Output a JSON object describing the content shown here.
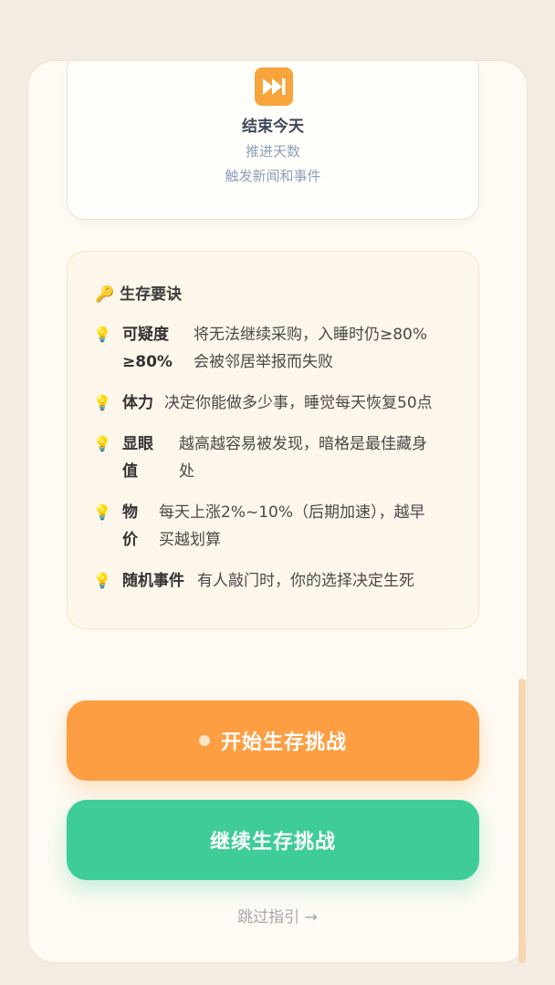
{
  "end_day_card": {
    "icon": "fast-forward-icon",
    "title": "结束今天",
    "desc_line1": "推进天数",
    "desc_line2": "触发新闻和事件"
  },
  "tips": {
    "title": "生存要诀",
    "title_icon": "key-icon",
    "bullet_icon": "lightbulb-icon",
    "items": [
      {
        "label": "可疑度≥80%",
        "label_line1": "可疑度",
        "label_line2": "≥80%",
        "text": "将无法继续采购，入睡时仍≥80%会被邻居举报而失败",
        "text_line1": "将无法继续采购，入睡时仍≥80%",
        "text_line2": "会被邻居举报而失败"
      },
      {
        "label": "体力",
        "text": "决定你能做多少事，睡觉每天恢复50点"
      },
      {
        "label": "显眼值",
        "label_line1": "显眼",
        "label_line2": "值",
        "text": "越高越容易被发现，暗格是最佳藏身处",
        "text_line1": "越高越容易被发现，暗格是最佳藏身",
        "text_line2": "处"
      },
      {
        "label": "物价",
        "label_line1": "物",
        "label_line2": "价",
        "text": "每天上涨2%~10%（后期加速），越早买越划算",
        "text_line1": "每天上涨2%~10%（后期加速），越早",
        "text_line2": "买越划算"
      },
      {
        "label": "随机事件",
        "text": "有人敲门时，你的选择决定生死"
      }
    ]
  },
  "buttons": {
    "start_label": "开始生存挑战",
    "continue_label": "继续生存挑战"
  },
  "skip_label": "跳过指引 →",
  "colors": {
    "start_button": "#fd9e43",
    "continue_button": "#3ecc98",
    "panel_bg": "#fefbf4",
    "tips_bg": "#fdf6ea"
  }
}
